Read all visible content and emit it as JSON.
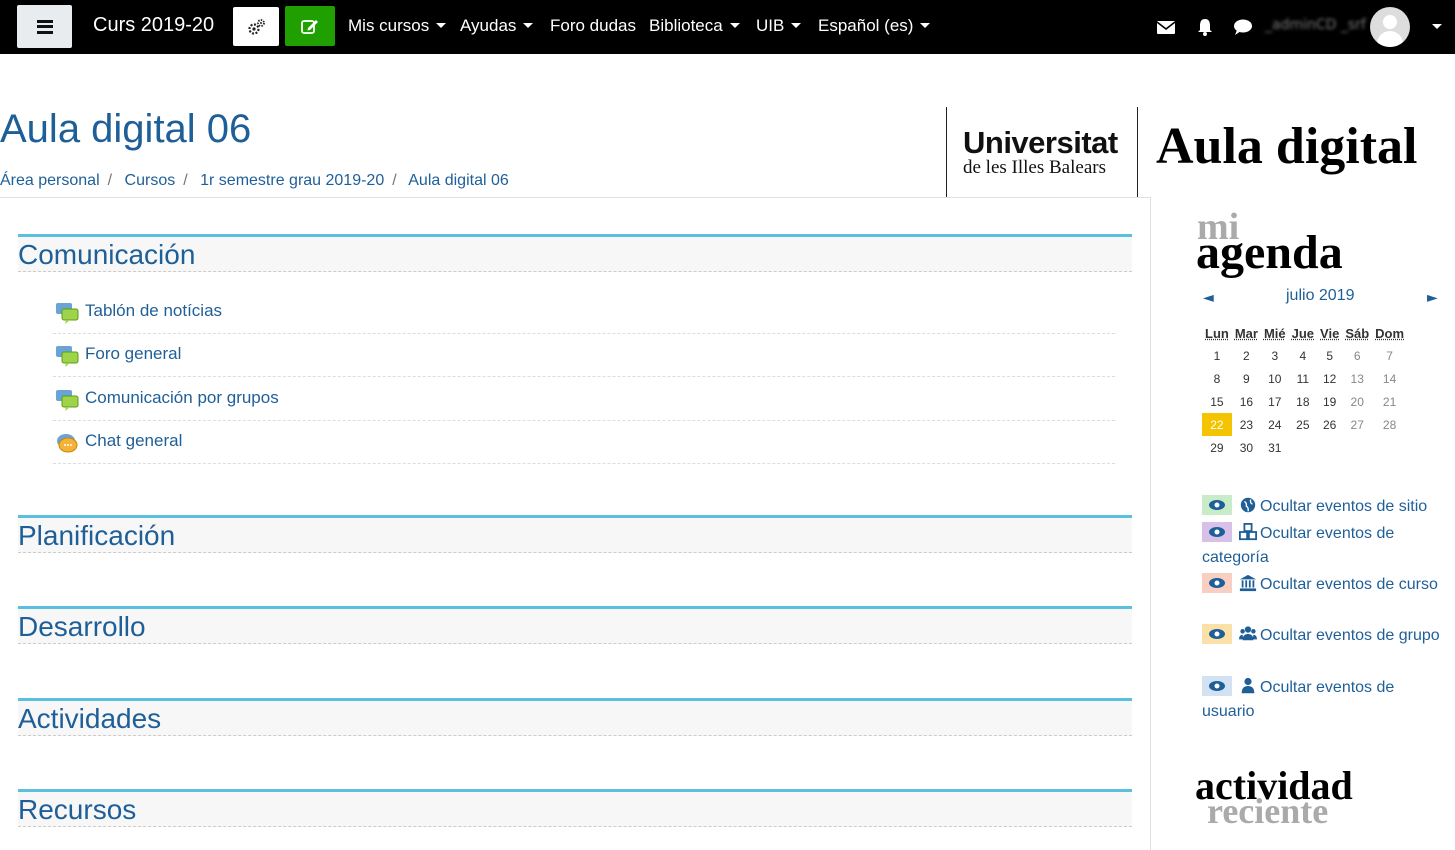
{
  "navbar": {
    "site_name": "Curs 2019-20",
    "menu": [
      {
        "label": "Mis cursos",
        "caret": true
      },
      {
        "label": "Ayudas",
        "caret": true
      },
      {
        "label": "Foro dudas",
        "caret": false
      },
      {
        "label": "Biblioteca",
        "caret": true
      },
      {
        "label": "UIB",
        "caret": true
      },
      {
        "label": "Español (es)",
        "caret": true
      }
    ],
    "username": "_adminCD _srf"
  },
  "header": {
    "title": "Aula digital 06",
    "breadcrumb": [
      "Área personal",
      "Cursos",
      "1r semestre grau 2019-20",
      "Aula digital 06"
    ],
    "logo_line1": "Universitat",
    "logo_line2": "de les Illes Balears",
    "brand": "Aula digital"
  },
  "sections": [
    {
      "name": "Comunicación",
      "activities": [
        {
          "label": "Tablón de notícias",
          "icon": "forum-icon"
        },
        {
          "label": "Foro general",
          "icon": "forum-icon"
        },
        {
          "label": "Comunicación por grupos",
          "icon": "forum-icon"
        },
        {
          "label": "Chat general",
          "icon": "chat-icon"
        }
      ]
    },
    {
      "name": "Planificación",
      "activities": []
    },
    {
      "name": "Desarrollo",
      "activities": []
    },
    {
      "name": "Actividades",
      "activities": []
    },
    {
      "name": "Recursos",
      "activities": []
    }
  ],
  "agenda": {
    "title_small": "mi",
    "title_big": "agenda",
    "prev": "◄",
    "next": "►",
    "month": "julio 2019",
    "weekdays": [
      "Lun",
      "Mar",
      "Mié",
      "Jue",
      "Vie",
      "Sáb",
      "Dom"
    ],
    "weeks": [
      [
        "1",
        "2",
        "3",
        "4",
        "5",
        "6",
        "7"
      ],
      [
        "8",
        "9",
        "10",
        "11",
        "12",
        "13",
        "14"
      ],
      [
        "15",
        "16",
        "17",
        "18",
        "19",
        "20",
        "21"
      ],
      [
        "22",
        "23",
        "24",
        "25",
        "26",
        "27",
        "28"
      ],
      [
        "29",
        "30",
        "31",
        "",
        "",
        "",
        ""
      ]
    ],
    "today": "22",
    "events": [
      {
        "label": "Ocultar eventos de sitio",
        "icon": "globe-icon",
        "color": "#c8ecc8"
      },
      {
        "label": "Ocultar eventos de categoría",
        "icon": "cubes-icon",
        "color": "#d8c0e8"
      },
      {
        "label": "Ocultar eventos de curso",
        "icon": "institution-icon",
        "color": "#f8cfc0"
      },
      {
        "label": "Ocultar eventos de grupo",
        "icon": "users-icon",
        "color": "#fbe0a8"
      },
      {
        "label": "Ocultar eventos de usuario",
        "icon": "user-icon",
        "color": "#d3e2f2"
      }
    ]
  },
  "recent": {
    "line1": "actividad",
    "line2": "reciente"
  },
  "colors": {
    "link": "#1f5f98",
    "section_border": "#5bc0de",
    "edit_button": "#20a000",
    "today": "#f4c400"
  }
}
